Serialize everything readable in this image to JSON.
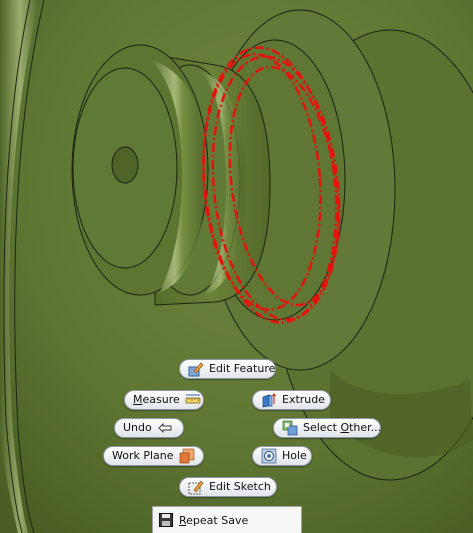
{
  "viewport": {
    "background": "#5d7331",
    "selection_color": "#e8120c"
  },
  "marking_menu": {
    "edit_feature": {
      "label": "Edit Feature",
      "icon": "edit-feature-icon"
    },
    "measure": {
      "label_first": "M",
      "label_rest": "easure",
      "icon": "ruler-icon"
    },
    "extrude": {
      "label": "Extrude",
      "icon": "extrude-icon"
    },
    "undo": {
      "label": "Undo",
      "icon": "undo-arrow-icon"
    },
    "select_other": {
      "label_pre": "Select ",
      "label_ul": "O",
      "label_post": "ther...",
      "icon": "select-other-icon"
    },
    "work_plane": {
      "label": "Work Plane",
      "icon": "work-plane-icon"
    },
    "hole": {
      "label": "Hole",
      "icon": "hole-icon"
    },
    "edit_sketch": {
      "label": "Edit Sketch",
      "icon": "edit-sketch-icon"
    }
  },
  "context_menu": {
    "repeat_save": {
      "label_ul": "R",
      "label_rest": "epeat Save",
      "icon": "floppy-disk-icon"
    }
  }
}
